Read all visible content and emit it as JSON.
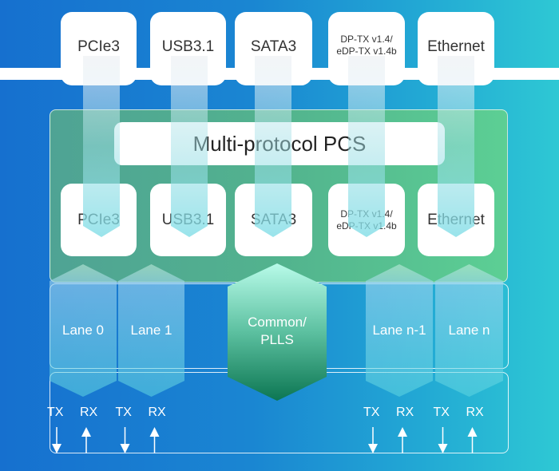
{
  "protocols_top": [
    {
      "label": "PCIe3"
    },
    {
      "label": "USB3.1"
    },
    {
      "label": "SATA3"
    },
    {
      "label": "DP-TX v1.4/\neDP-TX v1.4b"
    },
    {
      "label": "Ethernet"
    }
  ],
  "pcs": {
    "title": "Multi-protocol PCS",
    "protocols": [
      {
        "label": "PCIe3"
      },
      {
        "label": "USB3.1"
      },
      {
        "label": "SATA3"
      },
      {
        "label": "DP-TX v1.4/\neDP-TX v1.4b"
      },
      {
        "label": "Ethernet"
      }
    ]
  },
  "lanes": [
    {
      "label": "Lane 0",
      "tx": "TX",
      "rx": "RX"
    },
    {
      "label": "Lane 1",
      "tx": "TX",
      "rx": "RX"
    },
    {
      "label": "Lane n-1",
      "tx": "TX",
      "rx": "RX"
    },
    {
      "label": "Lane n",
      "tx": "TX",
      "rx": "RX"
    }
  ],
  "common": {
    "label": "Common/\nPLLS"
  },
  "colors": {
    "background_left": "#1670cf",
    "background_right": "#2ec8d4",
    "pcs_green": "#52b38e",
    "common_top": "#b4f5e6",
    "common_bottom": "#0e7a55"
  }
}
